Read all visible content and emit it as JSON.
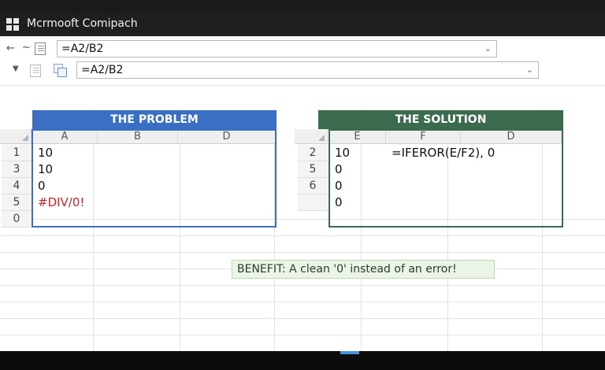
{
  "window": {
    "title": "Mcrmooft Comipach"
  },
  "formula_bar_1": {
    "value": "=A2/B2"
  },
  "formula_bar_2": {
    "value": "=A2/B2"
  },
  "problem": {
    "banner": "THE PROBLEM",
    "columns": [
      "A",
      "B",
      "D"
    ],
    "rows": [
      {
        "num": "1",
        "a": "10"
      },
      {
        "num": "3",
        "a": "10"
      },
      {
        "num": "4",
        "a": "0"
      },
      {
        "num": "5",
        "a": "#DIV/0!"
      },
      {
        "num": "0",
        "a": ""
      }
    ]
  },
  "solution": {
    "banner": "THE SOLUTION",
    "columns": [
      "E",
      "F",
      "D"
    ],
    "rows": [
      {
        "num": "2",
        "e": "10",
        "f": "=IFEROR(E/F2), 0"
      },
      {
        "num": "5",
        "e": "0",
        "f": ""
      },
      {
        "num": "6",
        "e": "0",
        "f": ""
      },
      {
        "num": "",
        "e": "0",
        "f": ""
      }
    ]
  },
  "benefit": {
    "text": "BENEFIT: A clean '0' instead of an error!"
  },
  "colors": {
    "problem": "#3a6fc4",
    "solution": "#3b6b4f",
    "error": "#c62828"
  }
}
